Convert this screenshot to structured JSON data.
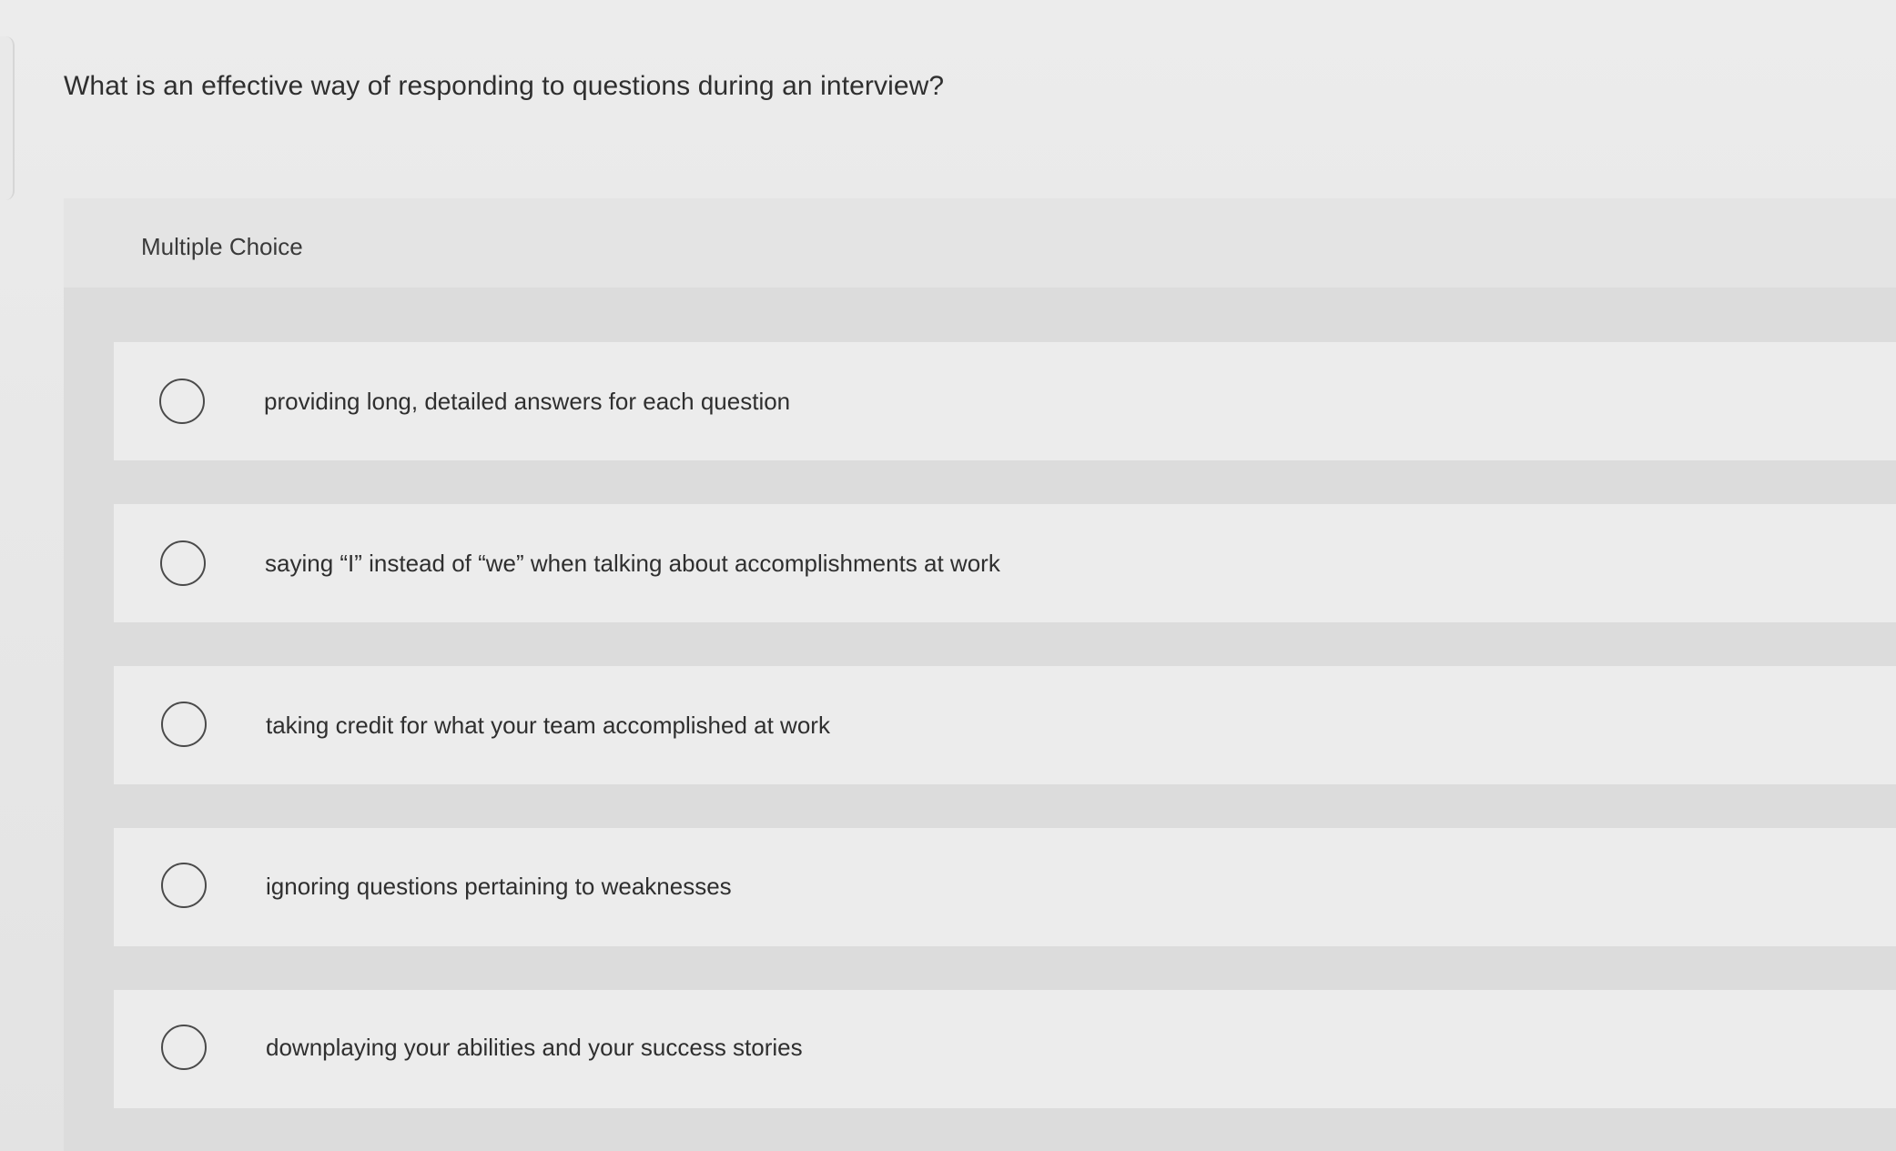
{
  "question": {
    "text": "What is an effective way of responding to questions during an interview?"
  },
  "multiple_choice": {
    "label": "Multiple Choice",
    "options": [
      {
        "label": "providing long, detailed answers for each question"
      },
      {
        "label": "saying “I” instead of “we” when talking about accomplishments at work"
      },
      {
        "label": "taking credit for what your team accomplished at work"
      },
      {
        "label": "ignoring questions pertaining to weaknesses"
      },
      {
        "label": "downplaying your abilities and your success stories"
      }
    ]
  },
  "colors": {
    "background": "#e6e6e6",
    "panel": "#dcdcdc",
    "option_row": "#ececec",
    "text": "#2f2f2f",
    "radio_border": "#4a4a4a"
  }
}
